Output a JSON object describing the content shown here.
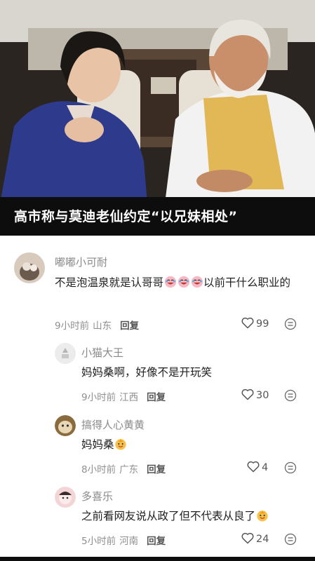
{
  "hero": {
    "caption": "高市称与莫迪老仙约定“以兄妹相处”"
  },
  "comments": [
    {
      "username": "嘟嘟小可耐",
      "text": "不是泡温泉就是认哥哥",
      "text_after_emoji": "以前干什么职业的",
      "time": "9小时前",
      "location": "山东",
      "reply_label": "回复",
      "likes": "99"
    },
    {
      "username": "小猫大王",
      "text": "妈妈桑啊，好像不是开玩笑",
      "time": "9小时前",
      "location": "江西",
      "reply_label": "回复",
      "likes": "30"
    },
    {
      "username": "搞得人心黄黄",
      "text": "妈妈桑",
      "time": "8小时前",
      "location": "广东",
      "reply_label": "回复",
      "likes": "4"
    },
    {
      "username": "多喜乐",
      "text": "之前看网友说从政了但不代表从良了",
      "time": "5小时前",
      "location": "河南",
      "reply_label": "回复",
      "likes": "24"
    }
  ],
  "icons": {
    "like": "heart-outline-icon",
    "more": "more-options-icon",
    "emoji_laugh": "laughing-face-emoji",
    "emoji_smile": "smiling-face-emoji"
  },
  "colors": {
    "caption_bg": "#0d0d0d",
    "username": "#8a8a8a",
    "meta": "#8f8f8f"
  }
}
